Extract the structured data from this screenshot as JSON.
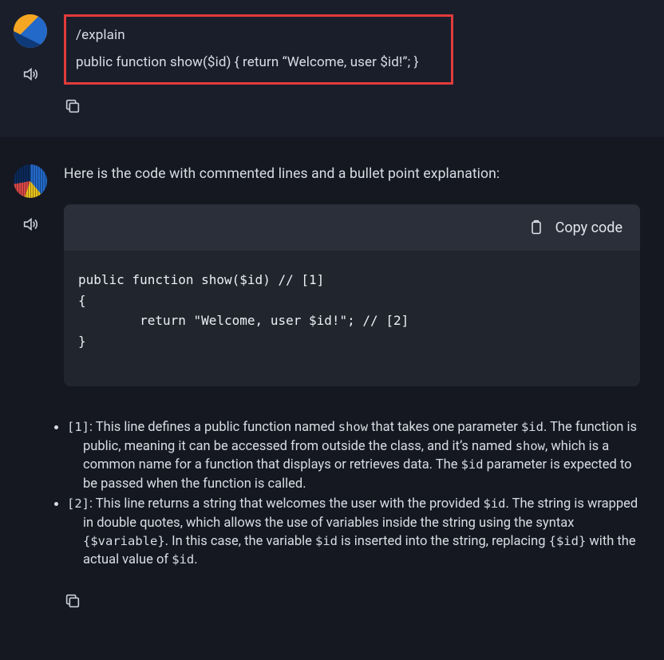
{
  "user_message": {
    "line1": "/explain",
    "line2": "public function show($id) { return “Welcome, user $id!”; }"
  },
  "assistant": {
    "intro": "Here is the code with commented lines and a bullet point explanation:",
    "copy_code_label": "Copy code",
    "code": "public function show($id) // [1]\n{\n        return \"Welcome, user $id!\"; // [2]\n}",
    "bullets": [
      {
        "tag": "[1]",
        "t1": ": This line defines a public function named ",
        "c1": "show",
        "t2": " that takes one parameter ",
        "c2": "$id",
        "t3": ". The function is public, meaning it can be accessed from outside the class, and it’s named ",
        "c3": "show",
        "t4": ", which is a common name for a function that displays or retrieves data. The ",
        "c4": "$id",
        "t5": " parameter is expected to be passed when the function is called."
      },
      {
        "tag": "[2]",
        "t1": ": This line returns a string that welcomes the user with the provided ",
        "c1": "$id",
        "t2": ". The string is wrapped in double quotes, which allows the use of variables inside the string using the syntax ",
        "c2": "{$variable}",
        "t3": ". In this case, the variable ",
        "c3": "$id",
        "t4": " is inserted into the string, replacing ",
        "c4": "{$id}",
        "t5": " with the actual value of ",
        "c5": "$id",
        "t6": "."
      }
    ]
  }
}
